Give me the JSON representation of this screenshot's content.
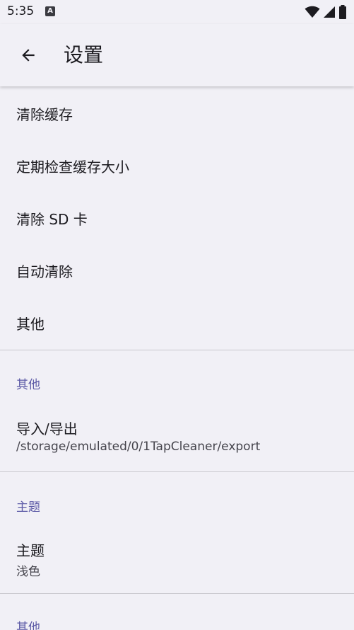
{
  "status_bar": {
    "time": "5:35",
    "notification_icon": "A"
  },
  "app_bar": {
    "title": "设置"
  },
  "general": {
    "items": [
      {
        "title": "清除缓存"
      },
      {
        "title": "定期检查缓存大小"
      },
      {
        "title": "清除 SD 卡"
      },
      {
        "title": "自动清除"
      },
      {
        "title": "其他"
      }
    ]
  },
  "category_other": {
    "title": "其他",
    "export": {
      "title": "导入/导出",
      "summary": "/storage/emulated/0/1TapCleaner/export"
    }
  },
  "category_theme": {
    "title": "主题",
    "theme": {
      "title": "主题",
      "summary": "浅色"
    }
  },
  "category_other2": {
    "title": "其他"
  },
  "colors": {
    "background": "#f1f0f6",
    "accent": "#5c5aa6",
    "text_primary": "#1c1b20",
    "text_secondary": "#45444c"
  }
}
